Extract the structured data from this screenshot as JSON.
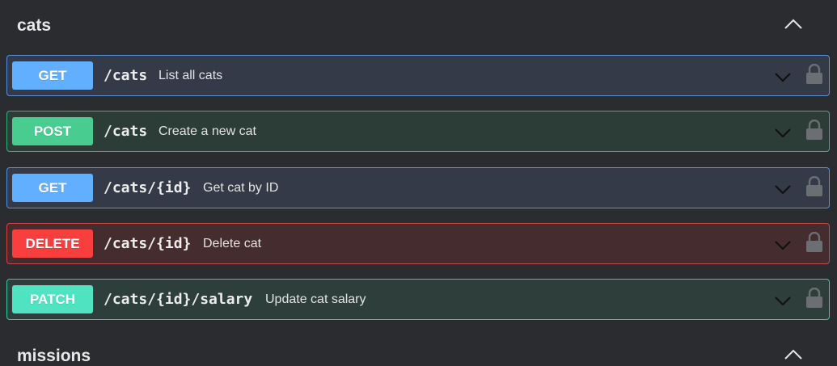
{
  "sections": [
    {
      "title": "cats"
    },
    {
      "title": "missions"
    }
  ],
  "operations": [
    {
      "method": "GET",
      "path": "/cats",
      "summary": "List all cats"
    },
    {
      "method": "POST",
      "path": "/cats",
      "summary": "Create a new cat"
    },
    {
      "method": "GET",
      "path": "/cats/{id}",
      "summary": "Get cat by ID"
    },
    {
      "method": "DELETE",
      "path": "/cats/{id}",
      "summary": "Delete cat"
    },
    {
      "method": "PATCH",
      "path": "/cats/{id}/salary",
      "summary": "Update cat salary"
    }
  ],
  "colors": {
    "GET": "#61affe",
    "POST": "#49cc90",
    "DELETE": "#f93e3e",
    "PATCH": "#50e3c2",
    "background": "#2b2c2f"
  },
  "icons": {
    "collapse": "chevron-up-icon",
    "expand": "chevron-down-icon",
    "auth": "lock-icon"
  }
}
